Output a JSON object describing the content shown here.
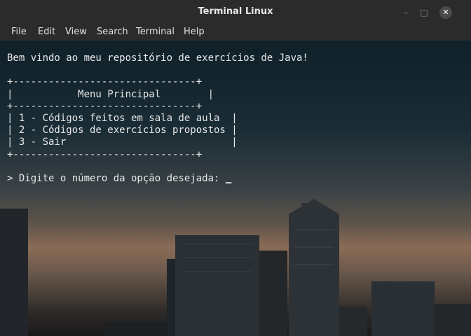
{
  "window": {
    "title": "Terminal Linux",
    "minimize_glyph": "–",
    "maximize_glyph": "□",
    "close_glyph": "✕"
  },
  "menubar": {
    "items": [
      "File",
      "Edit",
      "View",
      "Search",
      "Terminal",
      "Help"
    ]
  },
  "terminal": {
    "welcome": "Bem vindo ao meu repositório de exercícios de Java!",
    "border": "+-------------------------------+",
    "menu_title_line": "|           Menu Principal        |",
    "options": [
      "| 1 - Códigos feitos em sala de aula  |",
      "| 2 - Códigos de exercícios propostos |",
      "| 3 - Sair                            |"
    ],
    "prompt": "> Digite o número da opção desejada: ",
    "cursor": "_"
  },
  "colors": {
    "titlebar": "#2b2b2b",
    "text": "#e8e8e8",
    "sky_top": "#0f2029",
    "sky_glow": "#8a6b55"
  }
}
